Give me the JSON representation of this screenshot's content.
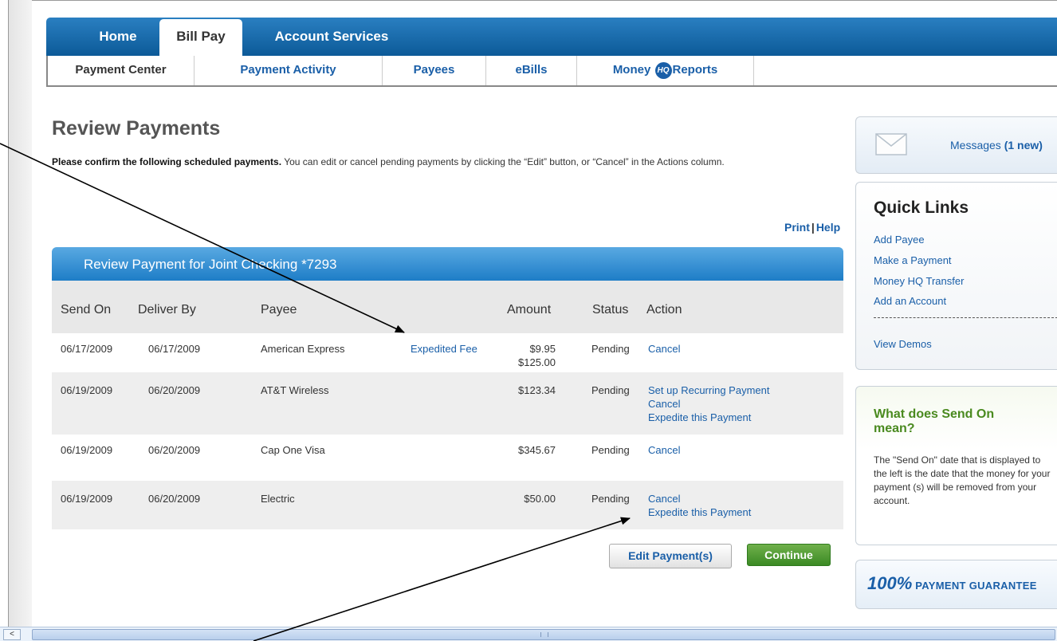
{
  "nav": {
    "primary": [
      {
        "label": "Home"
      },
      {
        "label": "Bill Pay"
      },
      {
        "label": "Account Services"
      }
    ],
    "secondary": [
      {
        "label": "Payment Center"
      },
      {
        "label": "Payment Activity"
      },
      {
        "label": "Payees"
      },
      {
        "label": "eBills"
      },
      {
        "label_before": "Money",
        "badge": "HQ",
        "label_after": "Reports"
      }
    ]
  },
  "main": {
    "title": "Review Payments",
    "intro_bold": "Please confirm the following scheduled payments.",
    "intro_rest": " You can edit or cancel pending payments by clicking the “Edit” button, or “Cancel” in the Actions column.",
    "print_label": "Print",
    "help_label": "Help",
    "table_title": "Review Payment for Joint Checking *7293",
    "columns": {
      "send_on": "Send On",
      "deliver_by": "Deliver By",
      "payee": "Payee",
      "amount": "Amount",
      "status": "Status",
      "action": "Action"
    },
    "rows": [
      {
        "send_on": "06/17/2009",
        "deliver_by": "06/17/2009",
        "payee": "American Express",
        "fee_link": "Expedited Fee",
        "amount_1": "$9.95",
        "amount_2": "$125.00",
        "status": "Pending",
        "actions": [
          "Cancel"
        ]
      },
      {
        "send_on": "06/19/2009",
        "deliver_by": "06/20/2009",
        "payee": "AT&T Wireless",
        "amount_1": "$123.34",
        "status": "Pending",
        "actions": [
          "Set up Recurring Payment",
          "Cancel",
          "Expedite this Payment"
        ]
      },
      {
        "send_on": "06/19/2009",
        "deliver_by": "06/20/2009",
        "payee": "Cap One Visa",
        "amount_1": "$345.67",
        "status": "Pending",
        "actions": [
          "Cancel"
        ]
      },
      {
        "send_on": "06/19/2009",
        "deliver_by": "06/20/2009",
        "payee": "Electric",
        "amount_1": "$50.00",
        "status": "Pending",
        "actions": [
          "Cancel",
          "Expedite this Payment"
        ]
      }
    ],
    "edit_button": "Edit Payment(s)",
    "continue_button": "Continue"
  },
  "sidebar": {
    "messages_label": "Messages",
    "messages_count": "(1 new)",
    "quick_links_title": "Quick Links",
    "quick_links": [
      "Add Payee",
      "Make a Payment",
      "Money HQ Transfer",
      "Add an Account"
    ],
    "view_demos": "View Demos",
    "faq_title": "What does Send On mean?",
    "faq_body": "The \"Send On\" date that is displayed to the left is the date that the money for your payment (s) will be removed from your account.",
    "guarantee_big": "100%",
    "guarantee_small": "PAYMENT GUARANTEE"
  },
  "scrollbar": {
    "left_arrow": "<"
  },
  "colors": {
    "nav_blue": "#0c5a98",
    "link_blue": "#1a5fa8",
    "continue_green": "#3b8a24",
    "faq_green": "#4a8a1f"
  }
}
